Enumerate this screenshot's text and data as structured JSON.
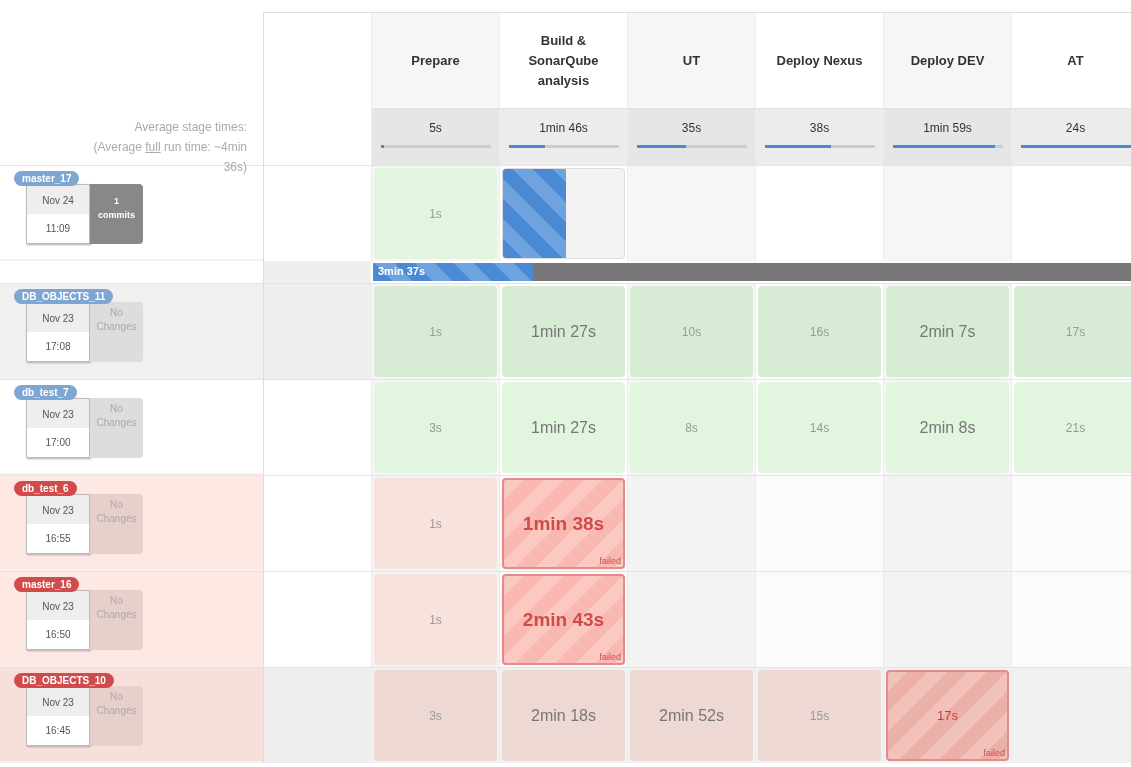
{
  "stages": [
    {
      "name": "Prepare"
    },
    {
      "name": "Build & SonarQube analysis"
    },
    {
      "name": "UT"
    },
    {
      "name": "Deploy Nexus"
    },
    {
      "name": "Deploy DEV"
    },
    {
      "name": "AT"
    }
  ],
  "averages": {
    "lines": [
      "Average stage times:",
      "(Average **full** run time: ~4min",
      "36s)"
    ],
    "items": [
      {
        "time": "5s",
        "level": 0.03
      },
      {
        "time": "1min 46s",
        "level": 0.33
      },
      {
        "time": "35s",
        "level": 0.45
      },
      {
        "time": "38s",
        "level": 0.6
      },
      {
        "time": "1min 59s",
        "level": 0.93
      },
      {
        "time": "24s",
        "level": 1.0
      }
    ]
  },
  "runs": [
    {
      "name": "master_17",
      "failed": false,
      "shaded": false,
      "date": "Nov 24",
      "time": "11:09",
      "has_changes": true,
      "changes": [
        "1",
        "commits"
      ],
      "progress": {
        "time": "3min 37s",
        "level": 0.21
      },
      "cells": [
        {
          "kind": "success",
          "time": "1s",
          "large": false
        },
        {
          "kind": "running",
          "level": 0.52
        },
        {
          "kind": "empty"
        },
        {
          "kind": "empty"
        },
        {
          "kind": "empty"
        },
        {
          "kind": "empty"
        }
      ]
    },
    {
      "name": "DB_OBJECTS_11",
      "failed": false,
      "shaded": true,
      "date": "Nov 23",
      "time": "17:08",
      "has_changes": false,
      "changes": [
        "No",
        "Changes"
      ],
      "cells": [
        {
          "kind": "success",
          "time": "1s",
          "large": false
        },
        {
          "kind": "success",
          "time": "1min 27s",
          "large": true
        },
        {
          "kind": "success",
          "time": "10s",
          "large": false
        },
        {
          "kind": "success",
          "time": "16s",
          "large": false
        },
        {
          "kind": "success",
          "time": "2min 7s",
          "large": true
        },
        {
          "kind": "success",
          "time": "17s",
          "large": false
        }
      ]
    },
    {
      "name": "db_test_7",
      "failed": false,
      "shaded": false,
      "date": "Nov 23",
      "time": "17:00",
      "has_changes": false,
      "changes": [
        "No",
        "Changes"
      ],
      "cells": [
        {
          "kind": "success",
          "time": "3s",
          "large": false
        },
        {
          "kind": "success",
          "time": "1min 27s",
          "large": true
        },
        {
          "kind": "success",
          "time": "8s",
          "large": false
        },
        {
          "kind": "success",
          "time": "14s",
          "large": false
        },
        {
          "kind": "success",
          "time": "2min 8s",
          "large": true
        },
        {
          "kind": "success",
          "time": "21s",
          "large": false
        }
      ]
    },
    {
      "name": "db_test_6",
      "failed": true,
      "shaded": false,
      "date": "Nov 23",
      "time": "16:55",
      "has_changes": false,
      "changes": [
        "No",
        "Changes"
      ],
      "cells": [
        {
          "kind": "success",
          "time": "1s",
          "large": false
        },
        {
          "kind": "failed",
          "time": "1min 38s",
          "large": true,
          "note": "failed"
        },
        {
          "kind": "empty"
        },
        {
          "kind": "empty"
        },
        {
          "kind": "empty"
        },
        {
          "kind": "empty"
        }
      ]
    },
    {
      "name": "master_16",
      "failed": true,
      "shaded": false,
      "date": "Nov 23",
      "time": "16:50",
      "has_changes": false,
      "changes": [
        "No",
        "Changes"
      ],
      "cells": [
        {
          "kind": "success",
          "time": "1s",
          "large": false
        },
        {
          "kind": "failed",
          "time": "2min 43s",
          "large": true,
          "note": "failed"
        },
        {
          "kind": "empty"
        },
        {
          "kind": "empty"
        },
        {
          "kind": "empty"
        },
        {
          "kind": "empty"
        }
      ]
    },
    {
      "name": "DB_OBJECTS_10",
      "failed": true,
      "shaded": true,
      "date": "Nov 23",
      "time": "16:45",
      "has_changes": false,
      "changes": [
        "No",
        "Changes"
      ],
      "cells": [
        {
          "kind": "success",
          "time": "3s",
          "large": false
        },
        {
          "kind": "success",
          "time": "2min 18s",
          "large": true
        },
        {
          "kind": "success",
          "time": "2min 52s",
          "large": true
        },
        {
          "kind": "success",
          "time": "15s",
          "large": false
        },
        {
          "kind": "failed",
          "time": "17s",
          "large": false,
          "note": "failed"
        },
        {
          "kind": "empty"
        }
      ]
    }
  ]
}
